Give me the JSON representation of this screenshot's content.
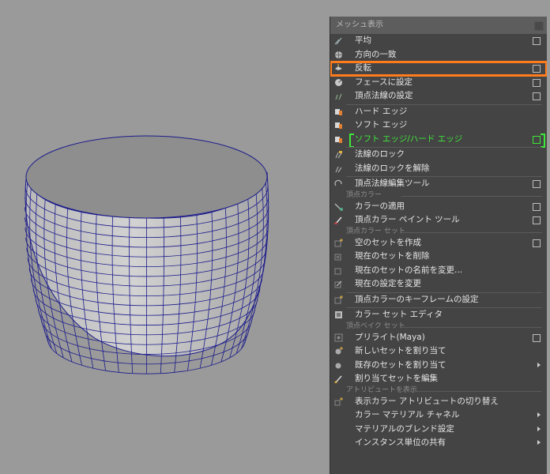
{
  "menu": {
    "title": "メッシュ表示",
    "items": [
      {
        "label": "平均",
        "icon": "average-normals-icon",
        "option": true
      },
      {
        "label": "方向の一致",
        "icon": "conform-icon"
      },
      {
        "label": "反転",
        "icon": "reverse-normals-icon",
        "option": true,
        "highlighted": true
      },
      {
        "label": "フェースに設定",
        "icon": "set-to-face-icon",
        "option": true
      },
      {
        "label": "頂点法線の設定",
        "icon": "set-vertex-normal-icon",
        "option": true
      },
      {
        "label": "ハード エッジ",
        "icon": "hard-edge-icon"
      },
      {
        "label": "ソフト エッジ",
        "icon": "soft-edge-icon"
      },
      {
        "label": "ソフト エッジ/ハード エッジ",
        "icon": "soft-hard-edge-icon",
        "option": true,
        "green": true
      },
      {
        "label": "法線のロック",
        "icon": "lock-normals-icon"
      },
      {
        "label": "法線のロックを解除",
        "icon": "unlock-normals-icon"
      },
      {
        "label": "頂点法線編集ツール",
        "icon": "vertex-normal-edit-tool-icon",
        "option": true
      },
      {
        "label": "カラーの適用",
        "icon": "apply-color-icon",
        "option": true
      },
      {
        "label": "頂点カラー ペイント ツール",
        "icon": "paint-vertex-color-icon",
        "option": true
      },
      {
        "label": "空のセットを作成",
        "icon": "create-empty-set-icon",
        "option": true
      },
      {
        "label": "現在のセットを削除",
        "icon": "delete-set-icon"
      },
      {
        "label": "現在のセットの名前を変更...",
        "icon": "rename-set-icon"
      },
      {
        "label": "現在の設定を変更",
        "icon": "modify-set-icon"
      },
      {
        "label": "頂点カラーのキーフレームの設定",
        "icon": "key-vertex-color-icon"
      },
      {
        "label": "カラー セット エディタ",
        "icon": "color-set-editor-icon"
      },
      {
        "label": "プリライト(Maya)",
        "icon": "prelight-icon",
        "option": true
      },
      {
        "label": "新しいセットを割り当て",
        "icon": "assign-new-set-icon"
      },
      {
        "label": "既存のセットを割り当て",
        "icon": "assign-existing-set-icon",
        "submenu": true
      },
      {
        "label": "割り当てセットを編集",
        "icon": "edit-assigned-sets-icon"
      },
      {
        "label": "表示カラー アトリビュートの切り替え",
        "icon": "toggle-display-color-icon"
      },
      {
        "label": "カラー マテリアル チャネル",
        "submenu": true
      },
      {
        "label": "マテリアルのブレンド設定",
        "submenu": true
      },
      {
        "label": "インスタンス単位の共有",
        "submenu": true
      }
    ],
    "sections": {
      "vertex_color": "頂点カラー",
      "vertex_color_sets": "頂点カラー セット",
      "vertex_bake_sets": "頂点ベイク セット",
      "attribute_display": "アトリビュートを表示"
    }
  },
  "colors": {
    "highlight": "#ff7b1c",
    "green": "#3ee83a",
    "wire": "#1c1c8c"
  }
}
